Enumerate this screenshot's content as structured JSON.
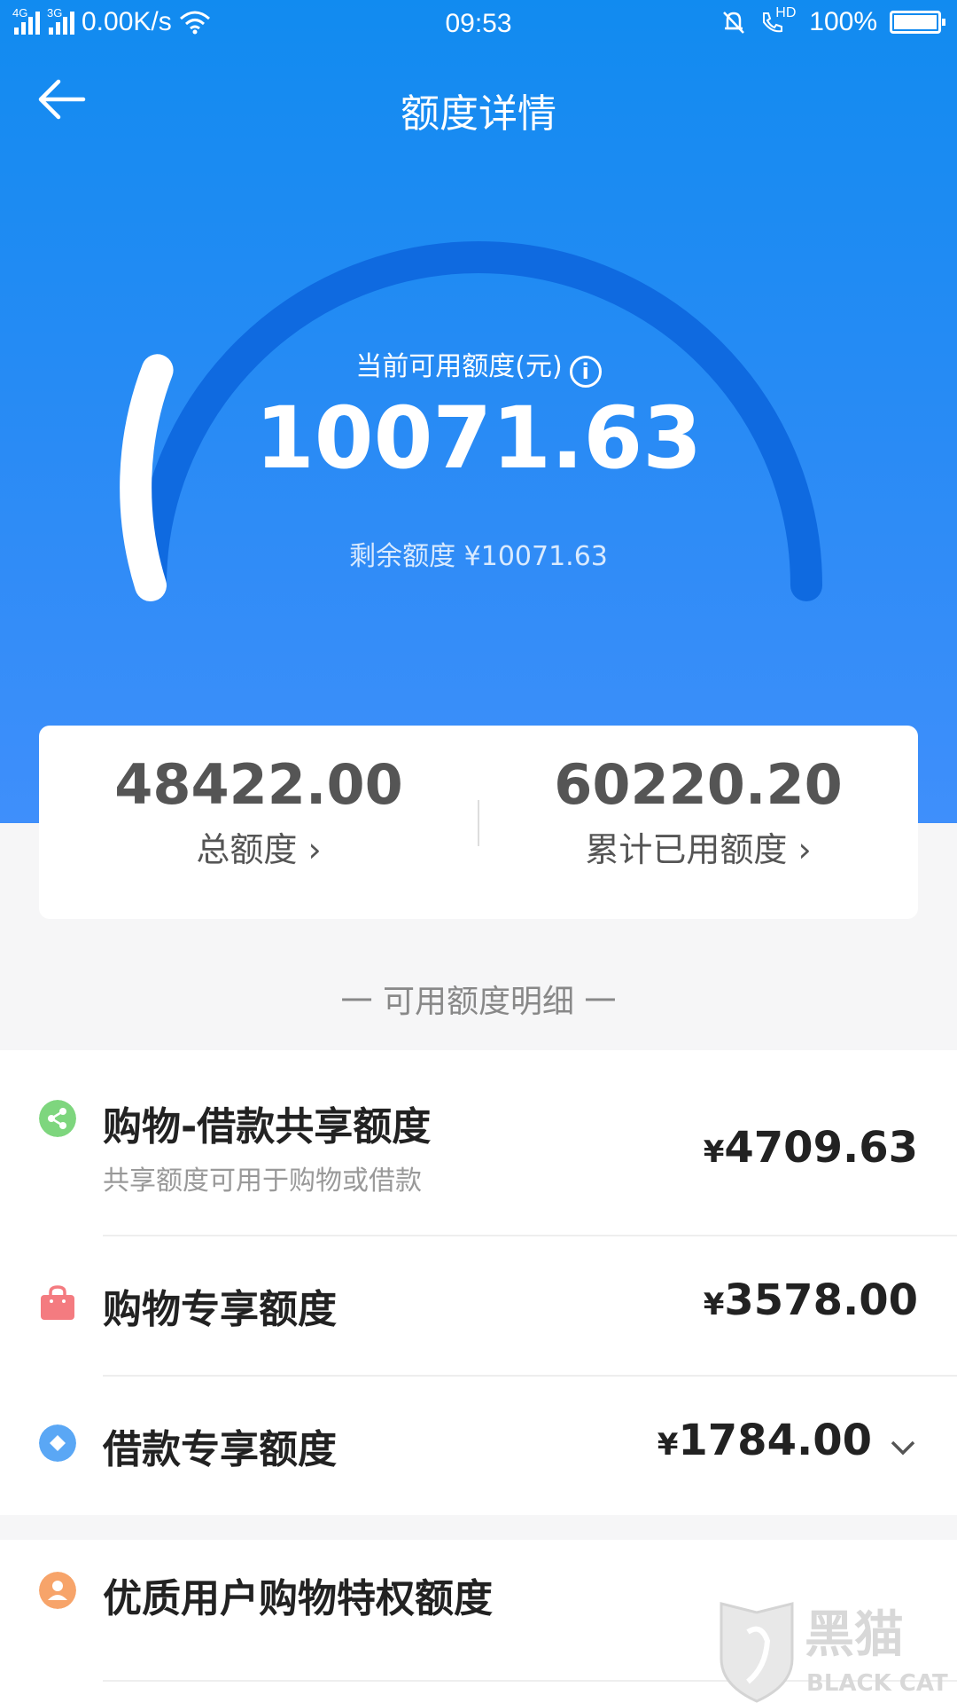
{
  "status_bar": {
    "net_4g": "4G",
    "net_3g": "3G",
    "speed": "0.00K/s",
    "time": "09:53",
    "hd": "HD",
    "battery": "100%",
    "battery_level": 1.0
  },
  "nav": {
    "title": "额度详情"
  },
  "gauge": {
    "label": "当前可用额度(元)",
    "info_glyph": "i",
    "value": "10071.63",
    "remaining": "剩余额度 ¥10071.63",
    "fill_fraction": 0.167
  },
  "summary": {
    "total_value": "48422.00",
    "total_label": "总额度",
    "used_value": "60220.20",
    "used_label": "累计已用额度",
    "chevron": "›"
  },
  "section_title": "一 可用额度明细 一",
  "items": [
    {
      "title": "购物-借款共享额度",
      "subtitle": "共享额度可用于购物或借款",
      "currency": "¥",
      "amount": "4709.63",
      "icon": "share-icon",
      "color": "#7ed67e"
    },
    {
      "title": "购物专享额度",
      "currency": "¥",
      "amount": "3578.00",
      "icon": "shopping-bag-icon",
      "color": "#f47b80"
    },
    {
      "title": "借款专享额度",
      "currency": "¥",
      "amount": "1784.00",
      "icon": "diamond-icon",
      "color": "#5aa7f5",
      "expand": "⌄"
    },
    {
      "title": "优质用户购物特权额度",
      "icon": "user-icon",
      "color": "#f7a46a"
    }
  ],
  "watermark": {
    "brand": "黑猫",
    "brand_en": "BLACK CAT"
  },
  "colors": {
    "hero_top": "#118bf0",
    "hero_bottom": "#3f8ffb",
    "arc_track": "#0f6ae0"
  }
}
